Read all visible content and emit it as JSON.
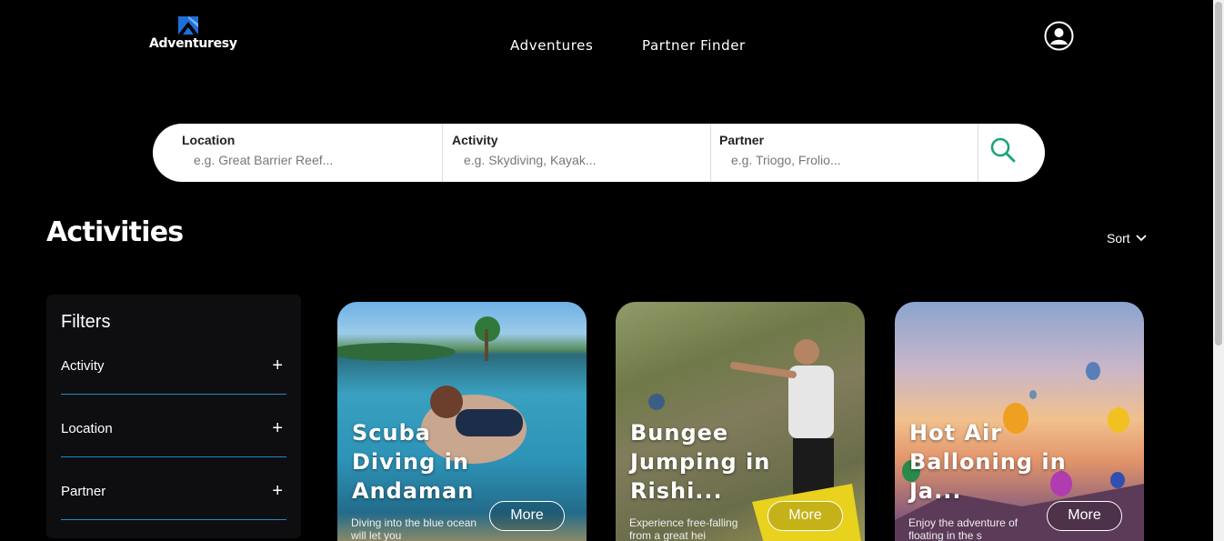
{
  "header": {
    "brand": "Adventuresy",
    "nav": [
      {
        "label": "Adventures"
      },
      {
        "label": "Partner Finder"
      }
    ]
  },
  "search": {
    "location": {
      "label": "Location",
      "placeholder": "e.g. Great Barrier Reef..."
    },
    "activity": {
      "label": "Activity",
      "placeholder": "e.g. Skydiving, Kayak..."
    },
    "partner": {
      "label": "Partner",
      "placeholder": "e.g. Triogo, Frolio..."
    }
  },
  "main": {
    "title": "Activities",
    "sort_label": "Sort"
  },
  "filters": {
    "title": "Filters",
    "items": [
      {
        "label": "Activity",
        "toggle": "+"
      },
      {
        "label": "Location",
        "toggle": "+"
      },
      {
        "label": "Partner",
        "toggle": "+"
      }
    ]
  },
  "cards": [
    {
      "title": "Scuba Diving in Andaman",
      "description": "Diving into the blue ocean will let you",
      "more": "More"
    },
    {
      "title": "Bungee Jumping in Rishi...",
      "description": "Experience free-falling from a great hei",
      "more": "More"
    },
    {
      "title": "Hot Air Balloning in Ja...",
      "description": "Enjoy the adventure of floating in the s",
      "more": "More"
    }
  ],
  "colors": {
    "background": "#000000",
    "accent_search_icon": "#1aa37a",
    "filter_divider": "#1e88c8",
    "logo_blue": "#1e6fd9"
  },
  "icons": {
    "logo": "mountain-logo-icon",
    "profile": "user-circle-icon",
    "search": "search-icon",
    "sort": "chevron-down-icon"
  }
}
